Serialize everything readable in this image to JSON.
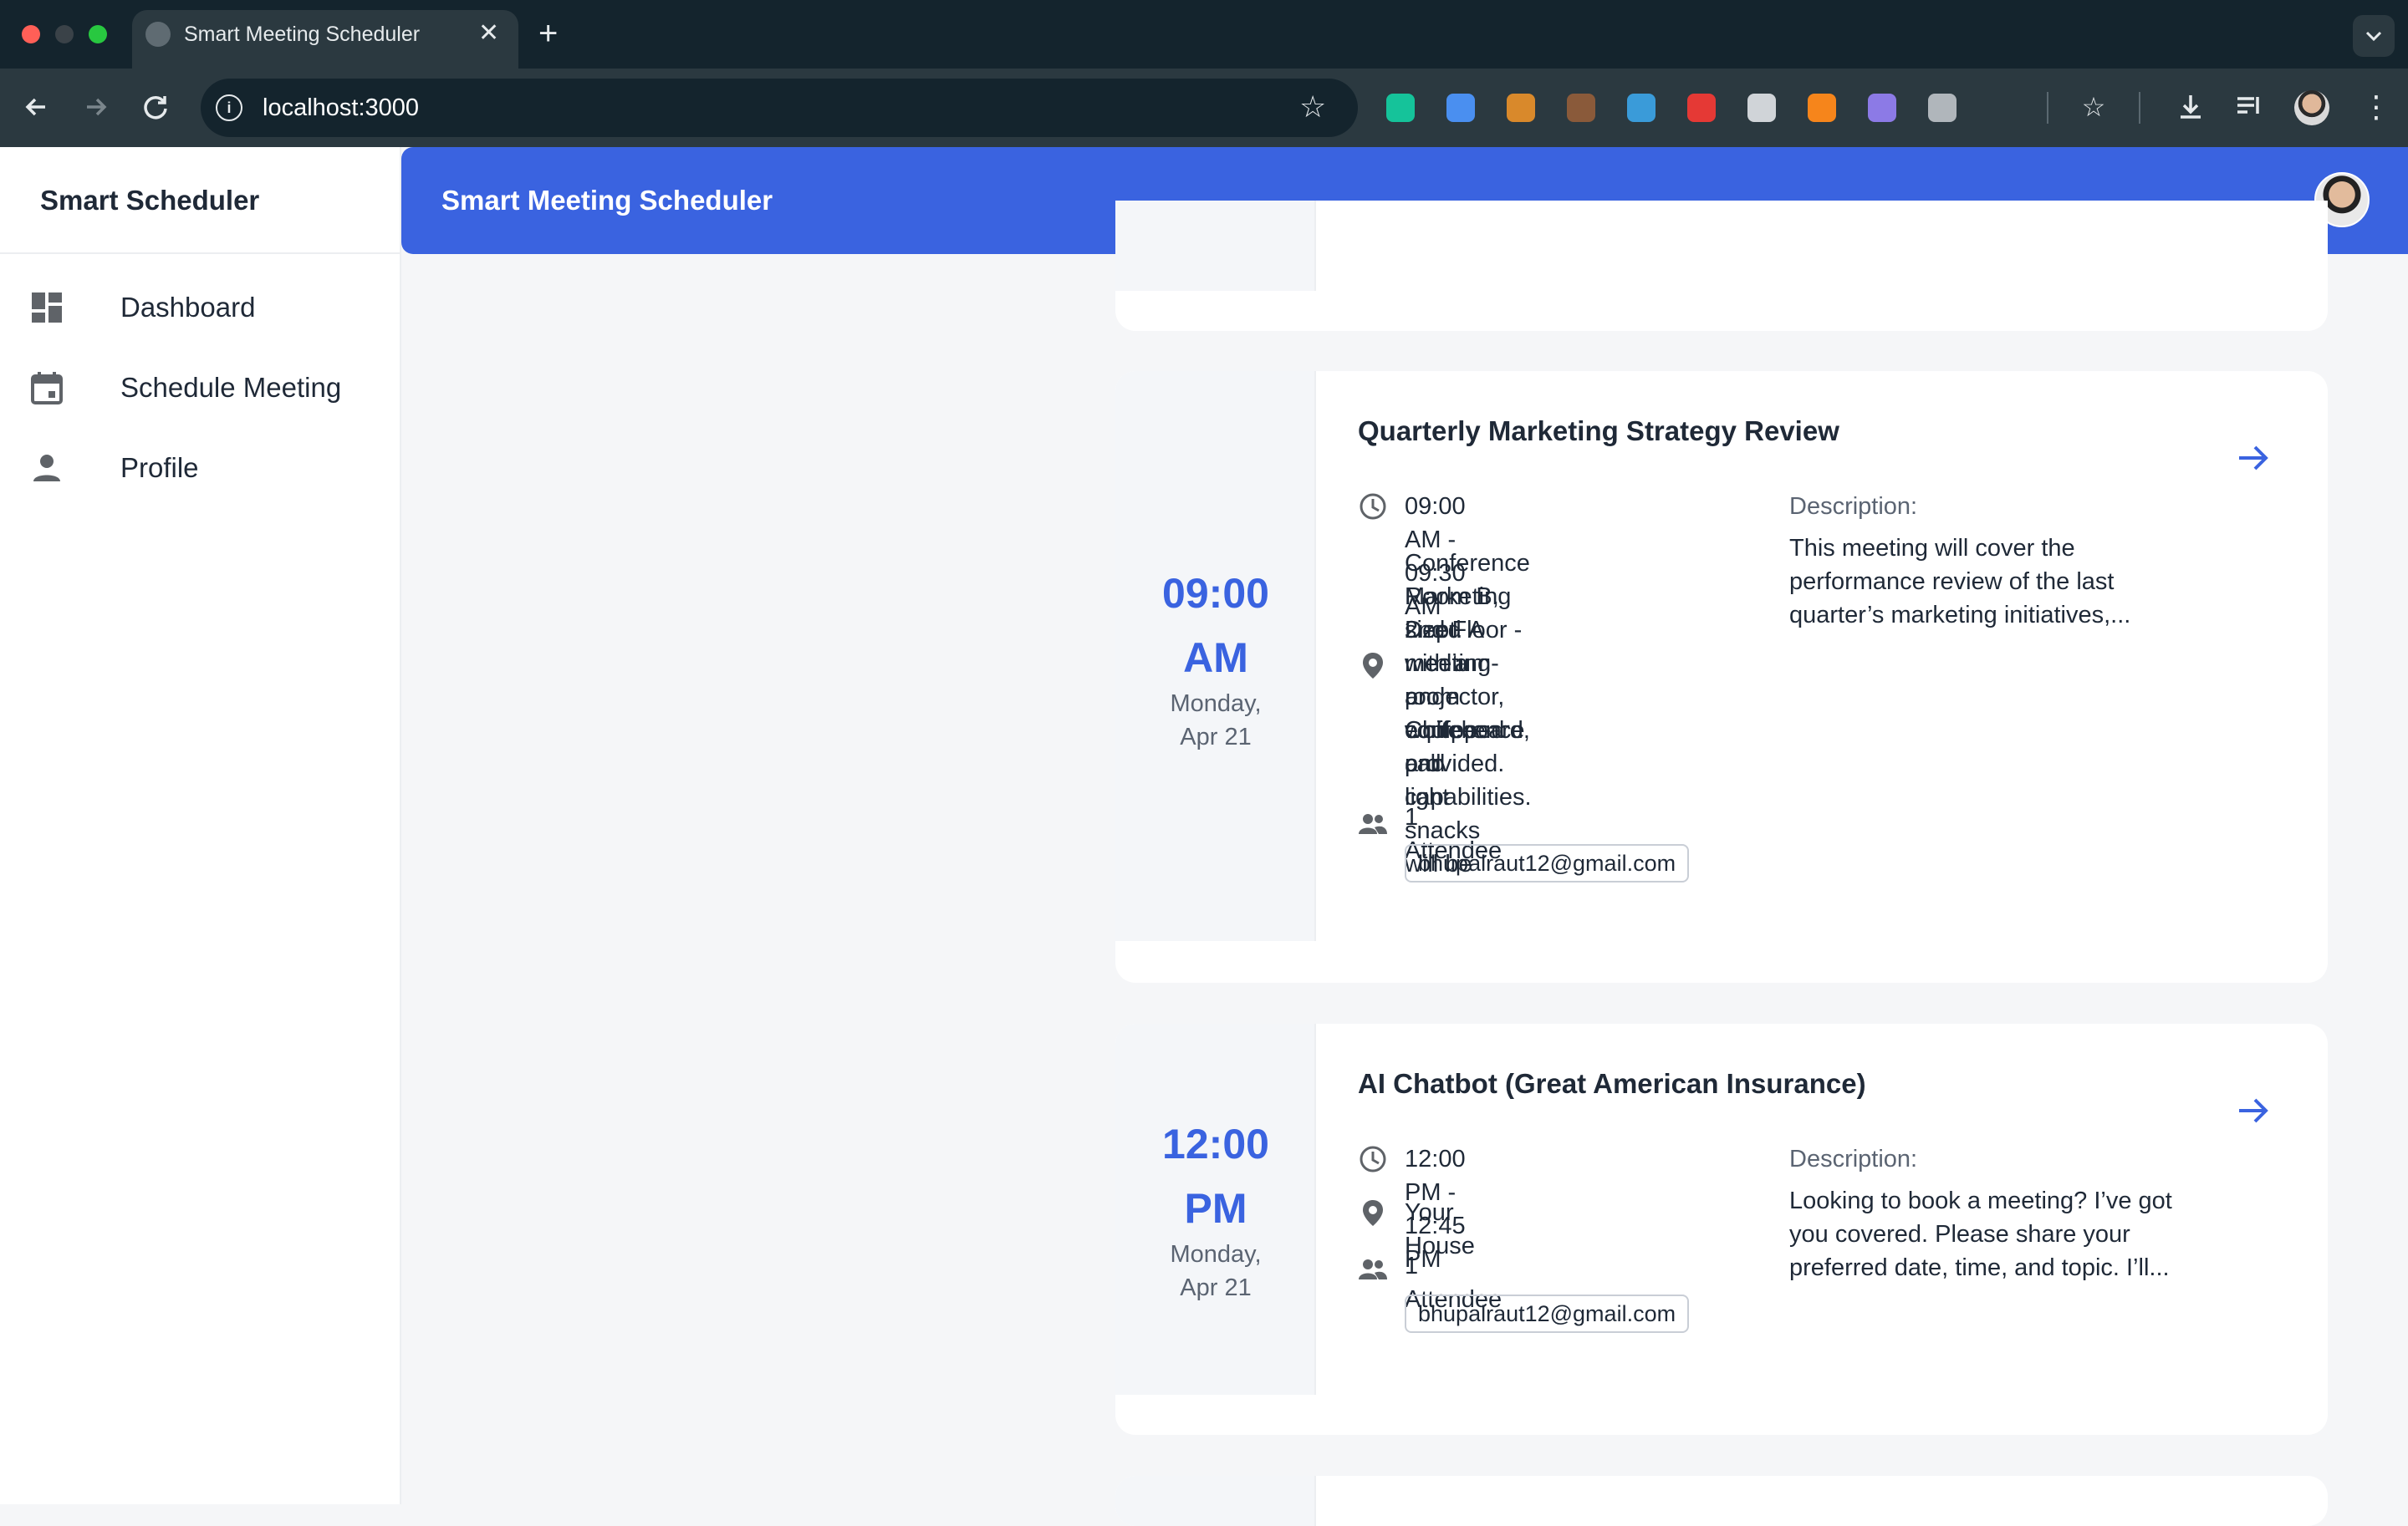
{
  "browser": {
    "tab_title": "Smart Meeting Scheduler",
    "tab_close": "✕",
    "new_tab": "+",
    "url": "localhost:3000",
    "extensions": [
      {
        "name": "grammarly-extension-icon",
        "color": "#15c39a"
      },
      {
        "name": "extension-2-icon",
        "color": "#4a8ff0"
      },
      {
        "name": "cookie-extension-icon",
        "color": "#d9892b"
      },
      {
        "name": "extension-4-icon",
        "color": "#8a5a3a"
      },
      {
        "name": "screenshot-extension-icon",
        "color": "#3a9bd9"
      },
      {
        "name": "youtube-extension-icon",
        "color": "#e53935"
      },
      {
        "name": "extension-7-icon",
        "color": "#d0d4d8"
      },
      {
        "name": "metamask-extension-icon",
        "color": "#f6851b"
      },
      {
        "name": "extension-9-icon",
        "color": "#8c7ae6"
      },
      {
        "name": "camera-extension-icon",
        "color": "#b0b6bb"
      }
    ]
  },
  "sidebar": {
    "brand": "Smart Scheduler",
    "items": [
      {
        "label": "Dashboard",
        "icon": "dashboard-icon"
      },
      {
        "label": "Schedule Meeting",
        "icon": "calendar-icon"
      },
      {
        "label": "Profile",
        "icon": "person-icon"
      }
    ]
  },
  "appbar": {
    "title": "Smart Meeting Scheduler"
  },
  "colors": {
    "accent": "#3a63e0",
    "sidebar_icon": "#5f6368"
  },
  "meetings": [
    {
      "time": "09:00",
      "ampm": "AM",
      "day": "Monday,",
      "date": "Apr 21",
      "title": "Quarterly Marketing Strategy Review",
      "time_range": "09:00 AM - 09:30 AM",
      "location_lines": [
        "Conference Room B, 2nd Floor -",
        "Marketing Dept. A medium-",
        "sized meeting room equipped",
        "with a projector, whiteboard,",
        "and conference call capabilities.",
        "Coffee and light snacks will be",
        "provided."
      ],
      "attendee_count": "1 Attendee",
      "attendee_email": "bhupalraut12@gmail.com",
      "description_label": "Description:",
      "description_lines": [
        "This meeting will cover the",
        "performance review of the last",
        "quarter’s marketing initiatives,..."
      ]
    },
    {
      "time": "12:00",
      "ampm": "PM",
      "day": "Monday,",
      "date": "Apr 21",
      "title": "AI Chatbot (Great American Insurance)",
      "time_range": "12:00 PM - 12:45 PM",
      "location_lines": [
        "Your House"
      ],
      "attendee_count": "1 Attendee",
      "attendee_email": "bhupalraut12@gmail.com",
      "description_label": "Description:",
      "description_lines": [
        "Looking to book a meeting? I’ve got",
        "you covered. Please share your",
        "preferred date, time, and topic. I’ll..."
      ]
    }
  ]
}
